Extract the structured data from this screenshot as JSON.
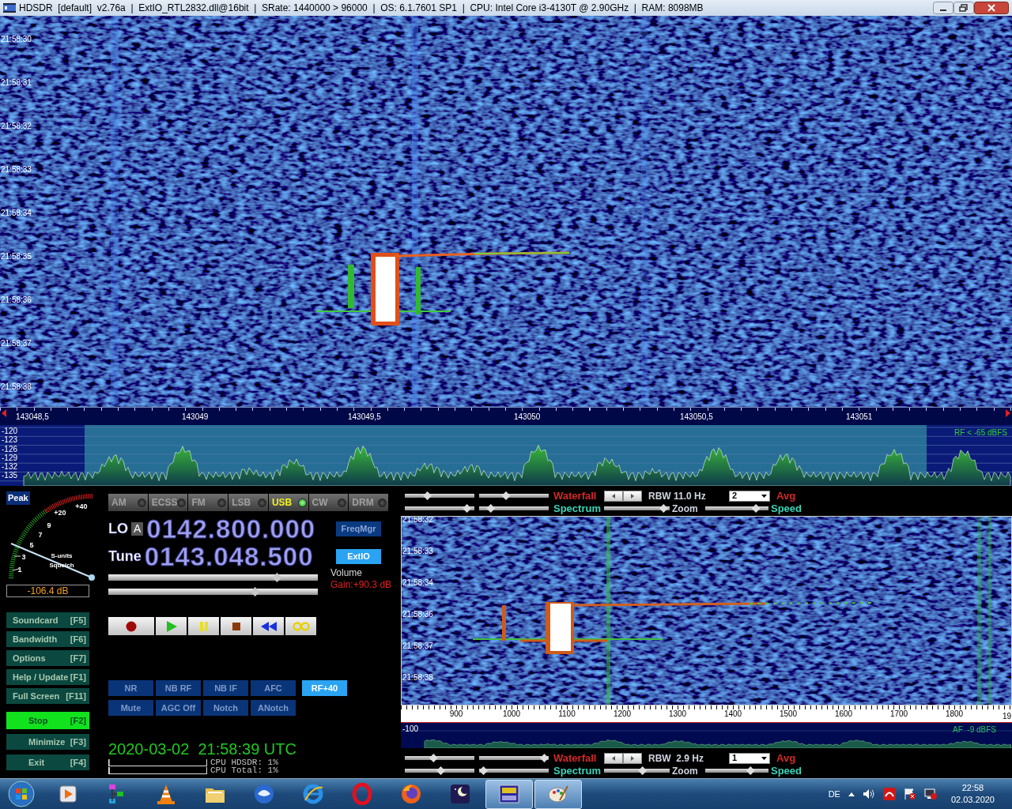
{
  "window": {
    "title": "HDSDR  [default]  v2.76a  |  ExtIO_RTL2832.dll@16bit  |  SRate: 1440000 > 96000  |  OS: 6.1.7601 SP1  |  CPU: Intel Core i3-4130T @ 2.90GHz  |  RAM: 8098MB"
  },
  "rf_waterfall": {
    "times": [
      "21:58:30",
      "21:58:31",
      "21:58:32",
      "21:58:33",
      "21:58:34",
      "21:58:35",
      "21:58:36",
      "21:58:37",
      "21:58:38"
    ]
  },
  "frequency_axis": {
    "labels": [
      "143048,5",
      "143049",
      "143049,5",
      "143050",
      "143050,5",
      "143051"
    ]
  },
  "rf_spectrum": {
    "y_labels": [
      "-120",
      "-123",
      "-126",
      "-129",
      "-132",
      "-135"
    ],
    "readout": "RF < -65 dBFS"
  },
  "s_meter": {
    "peak_button": "Peak",
    "scale": [
      "+40",
      "+20",
      "9",
      "7",
      "5",
      "3",
      "1"
    ],
    "captions": [
      "S-units",
      "Squelch"
    ],
    "reading": "-106.4 dB"
  },
  "function_buttons": [
    {
      "label": "Soundcard",
      "key": "[F5]"
    },
    {
      "label": "Bandwidth",
      "key": "[F6]"
    },
    {
      "label": "Options",
      "key": "[F7]"
    },
    {
      "label": "Help / Update",
      "key": "[F1]"
    },
    {
      "label": "Full Screen",
      "key": "[F11]"
    }
  ],
  "run_buttons": [
    {
      "label": "Stop",
      "key": "[F2]",
      "on": true
    },
    {
      "label": "Minimize",
      "key": "[F3]",
      "on": false
    },
    {
      "label": "Exit",
      "key": "[F4]",
      "on": false
    }
  ],
  "modes": [
    {
      "label": "AM",
      "selected": false
    },
    {
      "label": "ECSS",
      "selected": false
    },
    {
      "label": "FM",
      "selected": false
    },
    {
      "label": "LSB",
      "selected": false
    },
    {
      "label": "USB",
      "selected": true
    },
    {
      "label": "CW",
      "selected": false
    },
    {
      "label": "DRM",
      "selected": false
    }
  ],
  "lo": {
    "label": "LO",
    "vfo": "A",
    "frequency": "0142.800.000"
  },
  "tune": {
    "label": "Tune",
    "frequency": "0143.048.500"
  },
  "side_buttons": [
    {
      "label": "FreqMgr",
      "on": false
    },
    {
      "label": "ExtIO",
      "on": true
    }
  ],
  "volume": {
    "label": "Volume",
    "level": 0.82
  },
  "gain": {
    "label": "Gain:+90.3 dB",
    "level": 0.71
  },
  "dsp_rows": [
    [
      {
        "label": "NR",
        "on": false
      },
      {
        "label": "NB RF",
        "on": false
      },
      {
        "label": "NB IF",
        "on": false
      },
      {
        "label": "AFC",
        "on": false
      },
      {
        "label": "RF+40",
        "on": true
      }
    ],
    [
      {
        "label": "Mute",
        "on": false
      },
      {
        "label": "AGC Off",
        "on": false
      },
      {
        "label": "Notch",
        "on": false
      },
      {
        "label": "ANotch",
        "on": false
      }
    ]
  ],
  "clock": {
    "datetime": "2020-03-02  21:58:39 UTC",
    "cpu": [
      {
        "label": "CPU HDSDR: 1%",
        "level": 0.01
      },
      {
        "label": "CPU Total: 1%",
        "level": 0.01
      }
    ]
  },
  "rf_controls": {
    "sliders": [
      {
        "level": 0.3
      },
      {
        "level": 0.37
      },
      {
        "level": 0.95
      },
      {
        "level": 0.12
      }
    ],
    "waterfall_label": "Waterfall",
    "spectrum_label": "Spectrum",
    "rbw": "RBW 11.0 Hz",
    "avg_value": "2",
    "avg_label": "Avg",
    "zoom": {
      "label": "Zoom",
      "level": 0.97
    },
    "speed": {
      "label": "Speed",
      "level": 0.85
    }
  },
  "af_waterfall": {
    "times": [
      "21:58:32",
      "21:58:33",
      "21:58:34",
      "21:58:36",
      "21:58:37",
      "21:58:38"
    ]
  },
  "af_axis": {
    "labels": [
      "900",
      "1000",
      "1100",
      "1200",
      "1300",
      "1400",
      "1500",
      "1600",
      "1700",
      "1800",
      "19"
    ]
  },
  "af_spectrum": {
    "y_labels": [
      "-100"
    ],
    "readout": "AF  -9 dBFS"
  },
  "af_controls": {
    "sliders": [
      {
        "level": 0.4
      },
      {
        "level": 1.0
      },
      {
        "level": 0.52
      },
      {
        "level": 0.0
      }
    ],
    "waterfall_label": "Waterfall",
    "spectrum_label": "Spectrum",
    "rbw": "RBW  2.9 Hz",
    "avg_value": "1",
    "avg_label": "Avg",
    "zoom": {
      "label": "Zoom",
      "level": 0.6
    },
    "speed": {
      "label": "Speed",
      "level": 0.75
    }
  },
  "taskbar": {
    "apps": [
      {
        "kind": "media",
        "open": false
      },
      {
        "kind": "flowchart",
        "open": false
      },
      {
        "kind": "cone",
        "open": false
      },
      {
        "kind": "folder",
        "open": false
      },
      {
        "kind": "bird",
        "open": false
      },
      {
        "kind": "ie",
        "open": false
      },
      {
        "kind": "opera",
        "open": false
      },
      {
        "kind": "firefox",
        "open": false
      },
      {
        "kind": "moon",
        "open": false
      },
      {
        "kind": "wrhd",
        "open": true
      },
      {
        "kind": "paint",
        "open": true
      }
    ],
    "language": "DE",
    "time": "22:58",
    "date": "02.03.2020"
  }
}
